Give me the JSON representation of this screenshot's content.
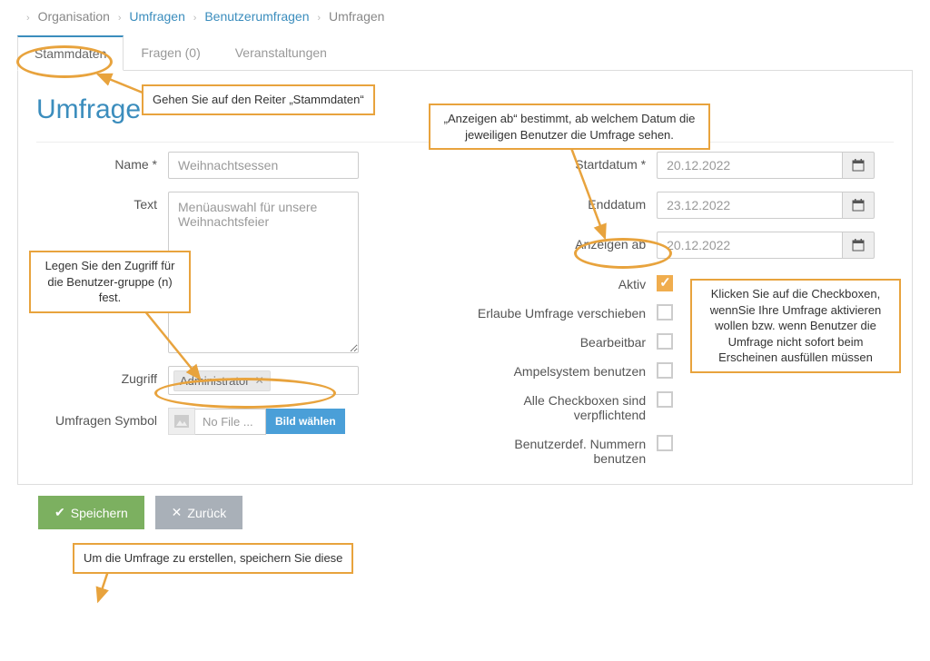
{
  "breadcrumb": {
    "items": [
      "Organisation",
      "Umfragen",
      "Benutzerumfragen",
      "Umfragen"
    ]
  },
  "tabs": {
    "stammdaten": "Stammdaten",
    "fragen": "Fragen (0)",
    "veranstaltungen": "Veranstaltungen"
  },
  "page_title": "Umfrage",
  "labels": {
    "name": "Name *",
    "text": "Text",
    "zugriff": "Zugriff",
    "symbol": "Umfragen Symbol",
    "startdatum": "Startdatum *",
    "enddatum": "Enddatum",
    "anzeigen_ab": "Anzeigen ab",
    "aktiv": "Aktiv",
    "verschieben": "Erlaube Umfrage verschieben",
    "bearbeitbar": "Bearbeitbar",
    "ampel": "Ampelsystem benutzen",
    "checkboxen": "Alle Checkboxen sind verpflichtend",
    "nummern": "Benutzerdef. Nummern benutzen"
  },
  "values": {
    "name": "Weihnachtsessen",
    "text": "Menüauswahl für unsere Weihnachtsfeier",
    "zugriff_tag": "Administrator",
    "file_label": "No File ...",
    "file_button": "Bild wählen",
    "startdatum": "20.12.2022",
    "enddatum": "23.12.2022",
    "anzeigen_ab": "20.12.2022"
  },
  "buttons": {
    "save": "Speichern",
    "back": "Zurück"
  },
  "callouts": {
    "stammdaten": "Gehen Sie auf den Reiter „Stammdaten“",
    "zugriff": "Legen Sie den Zugriff für die Benutzer-gruppe (n) fest.",
    "anzeigen": "„Anzeigen ab“ bestimmt, ab welchem Datum die jeweiligen Benutzer die Umfrage sehen.",
    "aktiv": "Klicken Sie auf die Checkboxen, wennSie Ihre Umfrage aktivieren wollen bzw. wenn Benutzer die Umfrage nicht sofort beim Erscheinen ausfüllen müssen",
    "save": "Um die Umfrage zu erstellen, speichern Sie diese"
  }
}
